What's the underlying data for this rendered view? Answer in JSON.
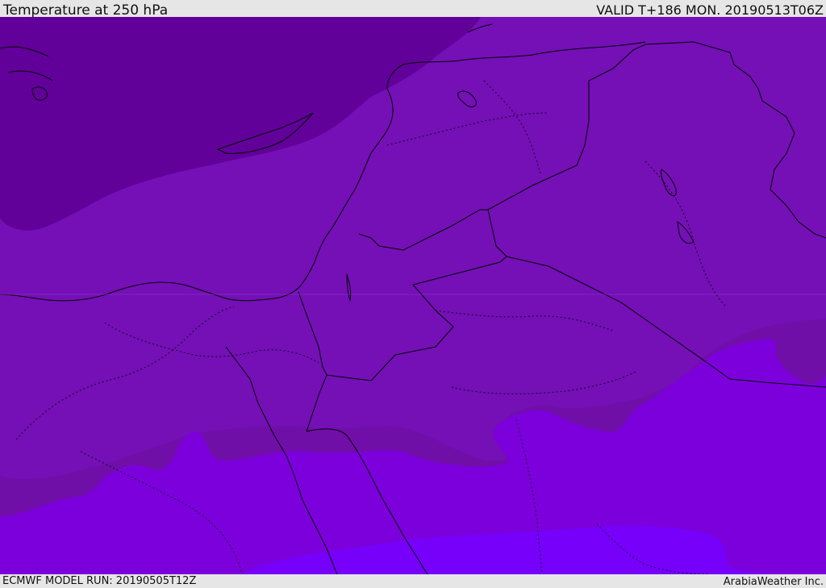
{
  "header": {
    "title": "Temperature at 250 hPa",
    "valid": "VALID T+186 MON. 20190513T06Z"
  },
  "footer": {
    "model_run": "ECMWF MODEL RUN: 20190505T12Z",
    "credit": "ArabiaWeather Inc."
  },
  "map": {
    "variable": "temperature",
    "pressure_level_hpa": 250,
    "colors": {
      "darkest": "#62009a",
      "dark": "#7410b6",
      "mid": "#700ea8",
      "light": "#7c00dc",
      "lightest": "#7600fa",
      "border_line": "#000000"
    }
  }
}
